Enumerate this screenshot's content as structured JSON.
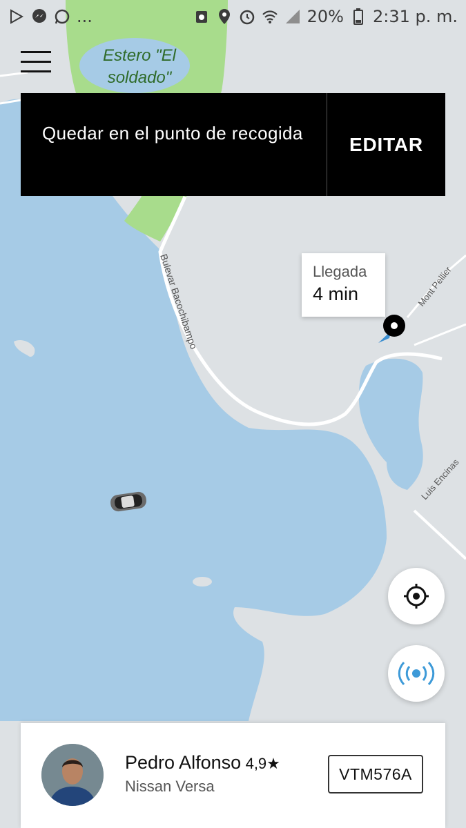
{
  "status_bar": {
    "left_icons": [
      "play-store-icon",
      "messenger-icon",
      "whatsapp-icon"
    ],
    "more": "...",
    "battery": "20%",
    "time": "2:31 p. m."
  },
  "map": {
    "lagoon_label": "Estero \"El\nsoldado\"",
    "street_bacochibampo": "Bulevar Bacochibampo",
    "street_mont_pellier": "Mont Pellier",
    "street_luis_encinas": "Luis Encinas",
    "colors": {
      "land": "#dde1e4",
      "water": "#a6cbe6",
      "park": "#a8dc8c",
      "road": "#ffffff"
    }
  },
  "menu": {
    "icon": "hamburger-menu-icon"
  },
  "pickup_banner": {
    "text": "Quedar en el punto de recogida",
    "edit_label": "EDITAR"
  },
  "eta": {
    "label": "Llegada",
    "value": "4 min"
  },
  "controls": {
    "locate_icon": "crosshair-icon",
    "beacon_icon": "beacon-icon"
  },
  "driver": {
    "name": "Pedro Alfonso",
    "rating": "4,9★",
    "car": "Nissan Versa",
    "plate": "VTM576A"
  }
}
